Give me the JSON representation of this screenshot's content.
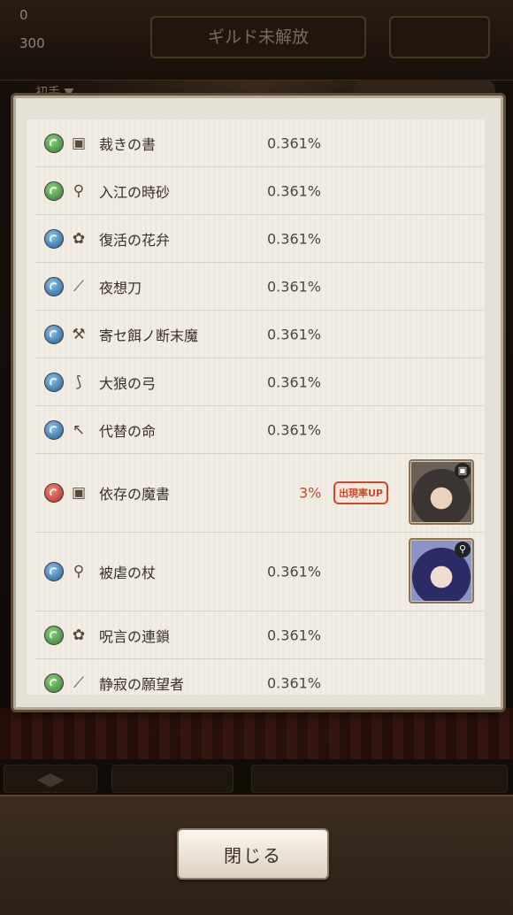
{
  "background": {
    "stat_top": "0",
    "stat_second": "300",
    "title": "ギルド未解放",
    "sub_label": "初手 ▼"
  },
  "drop_list": [
    {
      "attribute": "green",
      "type_icon": "book-icon",
      "name": "裁きの書",
      "rate": "0.361%"
    },
    {
      "attribute": "green",
      "type_icon": "staff-icon",
      "name": "入江の時砂",
      "rate": "0.361%"
    },
    {
      "attribute": "blue",
      "type_icon": "orb-icon",
      "name": "復活の花弁",
      "rate": "0.361%"
    },
    {
      "attribute": "blue",
      "type_icon": "sword-icon",
      "name": "夜想刀",
      "rate": "0.361%"
    },
    {
      "attribute": "blue",
      "type_icon": "hammer-icon",
      "name": "寄セ餌ノ断末魔",
      "rate": "0.361%"
    },
    {
      "attribute": "blue",
      "type_icon": "bow-icon",
      "name": "大狼の弓",
      "rate": "0.361%"
    },
    {
      "attribute": "blue",
      "type_icon": "spear-icon",
      "name": "代替の命",
      "rate": "0.361%"
    },
    {
      "attribute": "red",
      "type_icon": "book-icon",
      "name": "依存の魔書",
      "rate": "3%",
      "badge": "出現率UP",
      "portrait": "character-portrait-hooded"
    },
    {
      "attribute": "blue",
      "type_icon": "staff-icon",
      "name": "被虐の杖",
      "rate": "0.361%",
      "portrait": "character-portrait-blue-hair"
    },
    {
      "attribute": "green",
      "type_icon": "orb-icon",
      "name": "呪言の連鎖",
      "rate": "0.361%"
    },
    {
      "attribute": "green",
      "type_icon": "sword-icon",
      "name": "静寂の願望者",
      "rate": "0.361%"
    }
  ],
  "close_button": "閉じる"
}
